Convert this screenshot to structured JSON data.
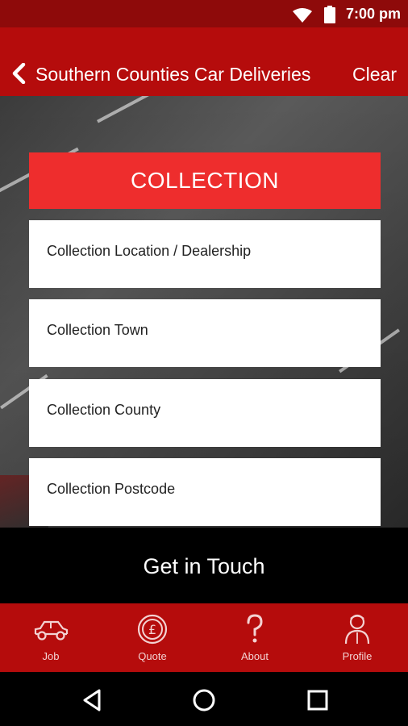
{
  "status": {
    "time": "7:00 pm"
  },
  "appbar": {
    "title": "Southern Counties Car Deliveries",
    "clear": "Clear"
  },
  "section": {
    "header": "COLLECTION"
  },
  "fields": [
    {
      "label": "Collection Location / Dealership"
    },
    {
      "label": "Collection Town"
    },
    {
      "label": "Collection County"
    },
    {
      "label": "Collection Postcode"
    }
  ],
  "cta": {
    "label": "Get in Touch"
  },
  "tabs": [
    {
      "label": "Job",
      "icon": "car-icon"
    },
    {
      "label": "Quote",
      "icon": "pound-coin-icon"
    },
    {
      "label": "About",
      "icon": "question-icon"
    },
    {
      "label": "Profile",
      "icon": "person-icon"
    }
  ],
  "colors": {
    "appbar": "#b50c0c",
    "statusbar": "#8e0a0a",
    "header": "#ee2d2d"
  }
}
